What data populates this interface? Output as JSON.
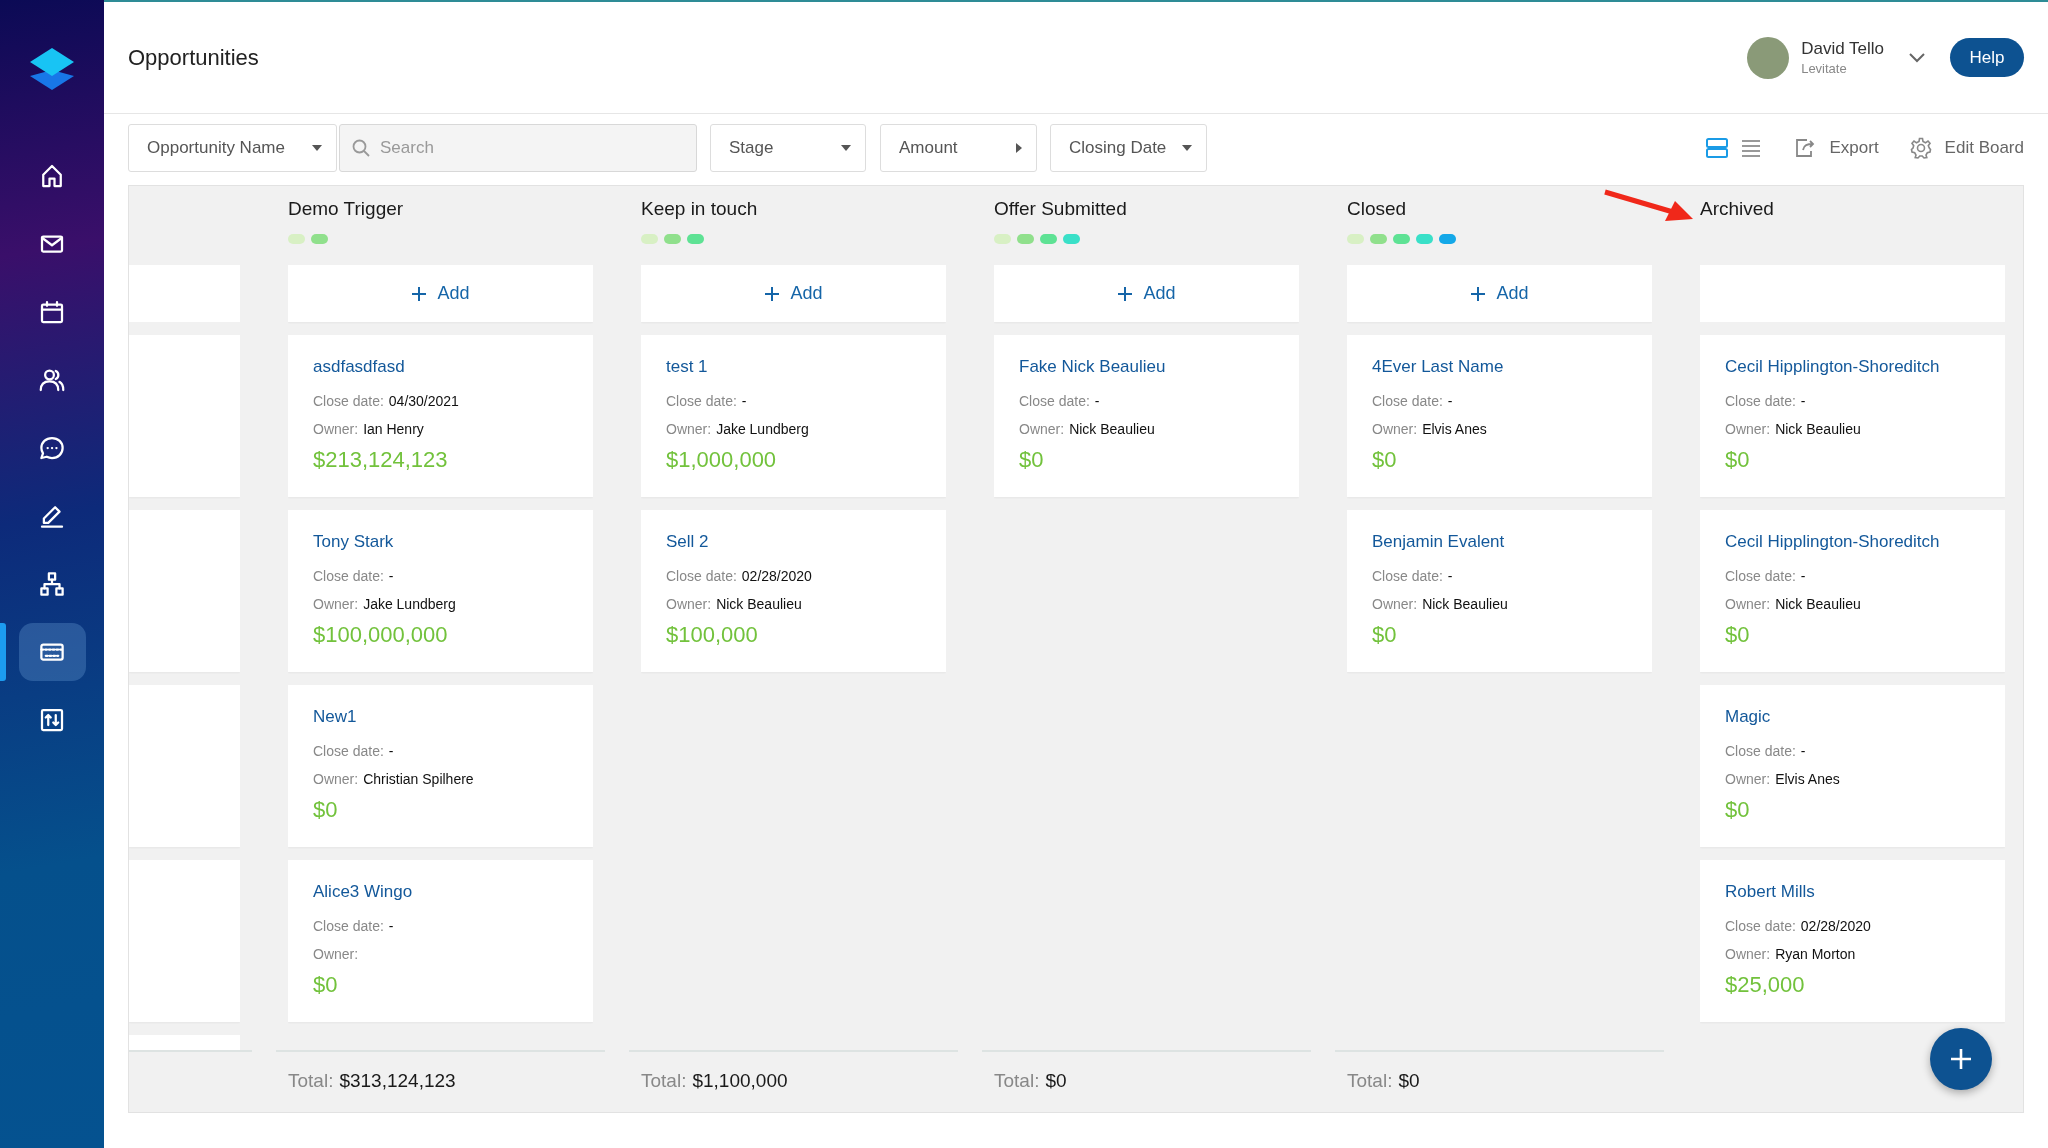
{
  "sidebar": {
    "items": [
      {
        "kind": "home",
        "selected": false
      },
      {
        "kind": "mail",
        "selected": false
      },
      {
        "kind": "calendar",
        "selected": false
      },
      {
        "kind": "people",
        "selected": false
      },
      {
        "kind": "chat",
        "selected": false
      },
      {
        "kind": "pen",
        "selected": false
      },
      {
        "kind": "hierarchy",
        "selected": false
      },
      {
        "kind": "card",
        "selected": true
      },
      {
        "kind": "transfer",
        "selected": false
      }
    ]
  },
  "header": {
    "title": "Opportunities",
    "user": {
      "name": "David Tello",
      "company": "Levitate"
    },
    "help_button": "Help"
  },
  "filters": {
    "name_select": "Opportunity Name",
    "search": {
      "placeholder": "Search"
    },
    "stage_select": "Stage",
    "amount_select": "Amount",
    "closing_date_select": "Closing Date"
  },
  "toolbar": {
    "views": [
      {
        "kind": "board",
        "selected": true
      },
      {
        "kind": "list",
        "selected": false
      }
    ],
    "export": "Export",
    "edit_board": "Edit Board"
  },
  "board": {
    "columns": [
      {
        "title": "Demo Trigger",
        "progress": [
          {
            "color": "#d8f0c4"
          },
          {
            "color": "#90e08c"
          }
        ],
        "add_label": "Add",
        "cards": [
          {
            "name": "asdfasdfasd",
            "close_date_label": "Close date:",
            "close_date": "04/30/2021",
            "owner_label": "Owner:",
            "owner": "Ian Henry",
            "amount": "$213,124,123"
          },
          {
            "name": "Tony Stark",
            "close_date_label": "Close date:",
            "close_date": "-",
            "owner_label": "Owner:",
            "owner": "Jake Lundberg",
            "amount": "$100,000,000"
          },
          {
            "name": "New1",
            "close_date_label": "Close date:",
            "close_date": "-",
            "owner_label": "Owner:",
            "owner": "Christian Spilhere",
            "amount": "$0"
          },
          {
            "name": "Alice3 Wingo",
            "close_date_label": "Close date:",
            "close_date": "-",
            "owner_label": "Owner:",
            "amount": "$0"
          }
        ],
        "total_label": "Total:",
        "total": "$313,124,123"
      },
      {
        "title": "Keep in touch",
        "progress": [
          {
            "color": "#d8f0c4"
          },
          {
            "color": "#90e08c"
          },
          {
            "color": "#5ee294"
          }
        ],
        "add_label": "Add",
        "cards": [
          {
            "name": "test 1",
            "close_date_label": "Close date:",
            "close_date": "-",
            "owner_label": "Owner:",
            "owner": "Jake Lundberg",
            "amount": "$1,000,000"
          },
          {
            "name": "Sell 2",
            "close_date_label": "Close date:",
            "close_date": "02/28/2020",
            "owner_label": "Owner:",
            "owner": "Nick Beaulieu",
            "amount": "$100,000"
          }
        ],
        "total_label": "Total:",
        "total": "$1,100,000"
      },
      {
        "title": "Offer Submitted",
        "progress": [
          {
            "color": "#d8f0c4"
          },
          {
            "color": "#90e08c"
          },
          {
            "color": "#5ee294"
          },
          {
            "color": "#3ae0c8"
          }
        ],
        "add_label": "Add",
        "cards": [
          {
            "name": "Fake Nick Beaulieu",
            "close_date_label": "Close date:",
            "close_date": "-",
            "owner_label": "Owner:",
            "owner": "Nick Beaulieu",
            "amount": "$0"
          }
        ],
        "total_label": "Total:",
        "total": "$0"
      },
      {
        "title": "Closed",
        "progress": [
          {
            "color": "#d8f0c4"
          },
          {
            "color": "#90e08c"
          },
          {
            "color": "#5ee294"
          },
          {
            "color": "#3ae0c8"
          },
          {
            "color": "#14a8e8"
          }
        ],
        "add_label": "Add",
        "cards": [
          {
            "name": "4Ever Last Name",
            "close_date_label": "Close date:",
            "close_date": "-",
            "owner_label": "Owner:",
            "owner": "Elvis Anes",
            "amount": "$0"
          },
          {
            "name": "Benjamin Evalent",
            "close_date_label": "Close date:",
            "close_date": "-",
            "owner_label": "Owner:",
            "owner": "Nick Beaulieu",
            "amount": "$0"
          }
        ],
        "total_label": "Total:",
        "total": "$0"
      },
      {
        "title": "Archived",
        "cards": [
          {
            "name": "Cecil Hipplington-Shoreditch",
            "close_date_label": "Close date:",
            "close_date": "-",
            "owner_label": "Owner:",
            "owner": "Nick Beaulieu",
            "amount": "$0"
          },
          {
            "name": "Cecil Hipplington-Shoreditch",
            "close_date_label": "Close date:",
            "close_date": "-",
            "owner_label": "Owner:",
            "owner": "Nick Beaulieu",
            "amount": "$0"
          },
          {
            "name": "Magic",
            "close_date_label": "Close date:",
            "close_date": "-",
            "owner_label": "Owner:",
            "owner": "Elvis Anes",
            "amount": "$0"
          },
          {
            "name": "Robert Mills",
            "close_date_label": "Close date:",
            "close_date": "02/28/2020",
            "owner_label": "Owner:",
            "owner": "Ryan Morton",
            "amount": "$25,000"
          }
        ]
      }
    ]
  }
}
